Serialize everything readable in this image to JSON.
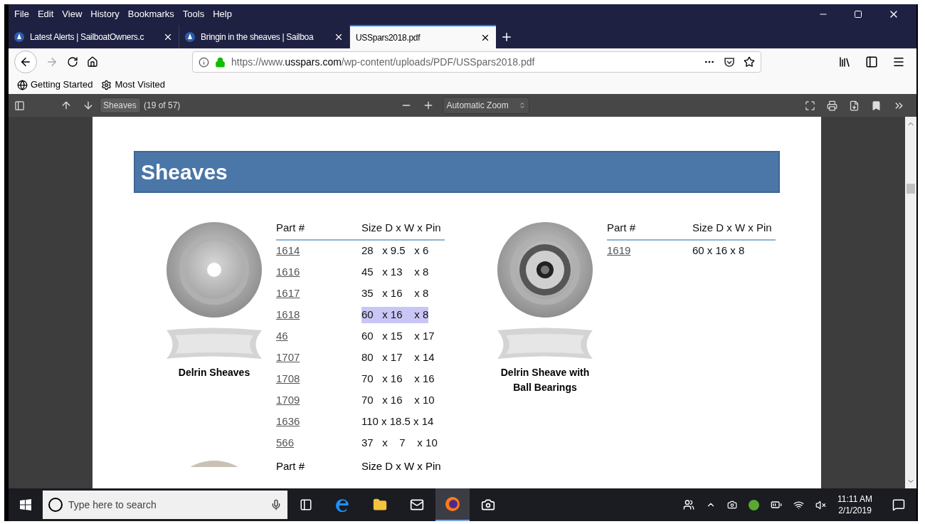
{
  "menu": [
    "File",
    "Edit",
    "View",
    "History",
    "Bookmarks",
    "Tools",
    "Help"
  ],
  "tabs": [
    {
      "title": "Latest Alerts | SailboatOwners.c",
      "selected": false
    },
    {
      "title": "Bringin in the sheaves | Sailboa",
      "selected": false
    },
    {
      "title": "USSpars2018.pdf",
      "selected": true
    }
  ],
  "url": {
    "prefix": "https://www.",
    "domain": "usspars.com",
    "path": "/wp-content/uploads/PDF/USSpars2018.pdf"
  },
  "bookmarks": [
    {
      "label": "Getting Started",
      "kind": "globe"
    },
    {
      "label": "Most Visited",
      "kind": "gear"
    }
  ],
  "pdf_toolbar": {
    "find_value": "Sheaves",
    "page_info": "(19 of 57)",
    "zoom": "Automatic Zoom"
  },
  "page": {
    "title": "Sheaves",
    "products": [
      {
        "caption": "Delrin Sheaves",
        "kind": "plain",
        "headers": [
          "Part #",
          "Size D x W x Pin"
        ],
        "rows": [
          {
            "part": "1614",
            "size": "28   x 9.5   x 6",
            "highlighted": false
          },
          {
            "part": "1616",
            "size": "45   x 13    x 8",
            "highlighted": false
          },
          {
            "part": "1617",
            "size": "35   x 16    x 8",
            "highlighted": false
          },
          {
            "part": "1618",
            "size": "60   x 16    x 8",
            "highlighted": true
          },
          {
            "part": "46",
            "size": "60   x 15    x 17",
            "highlighted": false
          },
          {
            "part": "1707",
            "size": "80   x 17    x 14",
            "highlighted": false
          },
          {
            "part": "1708",
            "size": "70   x 16    x 16",
            "highlighted": false
          },
          {
            "part": "1709",
            "size": "70   x 16    x 10",
            "highlighted": false
          },
          {
            "part": "1636",
            "size": "110 x 18.5 x 14",
            "highlighted": false
          },
          {
            "part": "566",
            "size": "37   x    7    x 10",
            "highlighted": false
          }
        ]
      },
      {
        "caption": "Delrin Sheave with Ball Bearings",
        "kind": "bearing",
        "headers": [
          "Part #",
          "Size D x W x Pin"
        ],
        "rows": [
          {
            "part": "1619",
            "size": "60 x 16 x 8",
            "highlighted": false
          }
        ]
      }
    ],
    "next_headers": [
      "Part #",
      "Size D x W x Pin"
    ]
  },
  "taskbar": {
    "search_placeholder": "Type here to search",
    "time": "11:11 AM",
    "date": "2/1/2019"
  }
}
